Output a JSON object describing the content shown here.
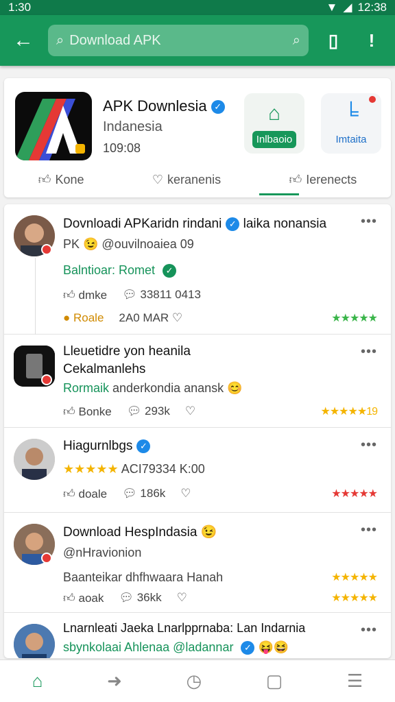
{
  "status": {
    "time": "1:30",
    "battery": "12:38"
  },
  "search": {
    "placeholder": "Download APK"
  },
  "header": {
    "title": "APK Downlesia",
    "subtitle": "Indanesia",
    "meta": "109:08",
    "tile1_label": "Inlbaoio",
    "tile2_label": "Imtaita",
    "tabs": [
      "Kone",
      "keranenis",
      "Ierenects"
    ]
  },
  "posts": [
    {
      "title": "Dovnloadi APKaridn rindani",
      "title_tail": "laika nonansia",
      "handle": "PK 😉 @ouvilnoaiea 09",
      "green": "Balntioar: Romet",
      "act1": "dmke",
      "act2": "33811 0413",
      "extra_tag": "Roale",
      "extra_date": "2A0 MAR",
      "stars": "★★★★★"
    },
    {
      "title": "Lleuetidre yon heanila",
      "line2": "Cekalmanlehs",
      "green": "Rormaik",
      "green_tail": "anderkondia anansk 😊",
      "act1": "Bonke",
      "act2": "293k",
      "stars": "★★★★★",
      "stars_num": "19"
    },
    {
      "title": "Hiagurnlbgs",
      "rating_text": "ACI79334 K:00",
      "act1": "doale",
      "act2": "186k",
      "stars": "★★★★★"
    },
    {
      "title": "Download HespIndasia 😉",
      "handle": "@nHravionion",
      "line2": "Baanteikar dhfhwaara Hanah",
      "act1": "aoak",
      "act2": "36kk",
      "stars": "★★★★★",
      "stars2": "★★★★★"
    },
    {
      "title": "Lnarnleati Jaeka Lnarlpprnaba: Lan Indarnia",
      "line2": "sbynkolaai Ahlenaa @ladannar",
      "emoji": "😝😆"
    }
  ],
  "colors": {
    "primary": "#17975a",
    "accent": "#1d8ae8",
    "star": "#f4b400",
    "star_green": "#3ab54a"
  }
}
